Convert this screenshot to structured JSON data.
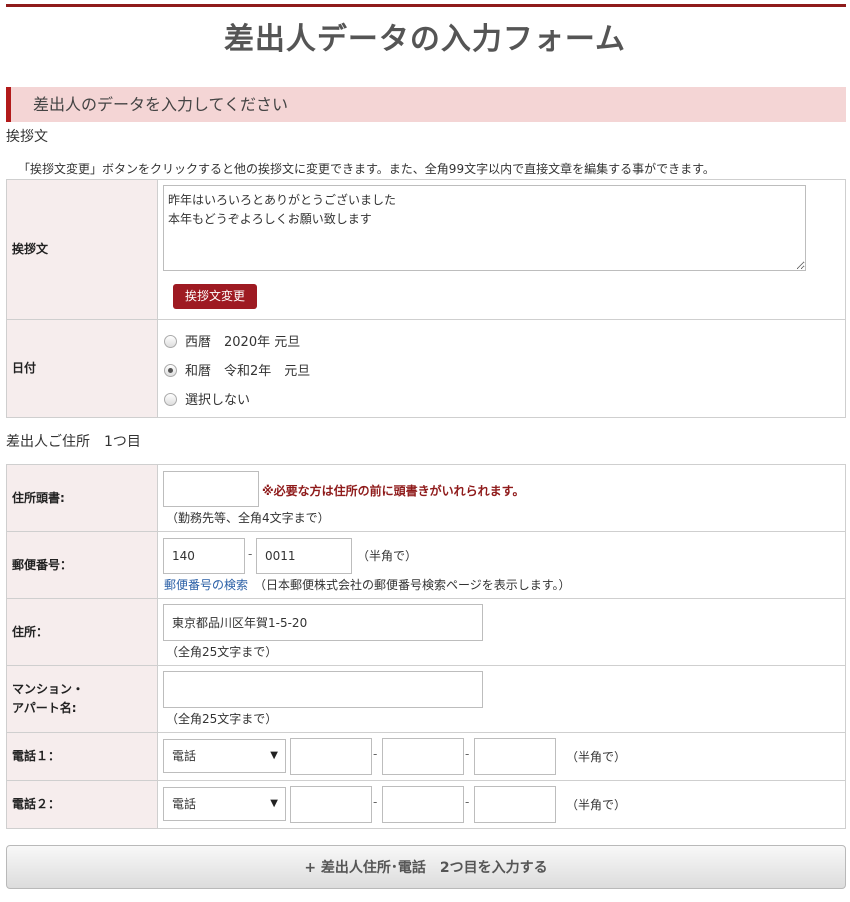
{
  "page": {
    "title": "差出人データの入力フォーム"
  },
  "section": {
    "title": "差出人のデータを入力してください"
  },
  "greeting": {
    "heading": "挨拶文",
    "note": "「挨拶文変更」ボタンをクリックすると他の挨拶文に変更できます。また、全角99文字以内で直接文章を編集する事ができます。",
    "label": "挨拶文",
    "text": "昨年はいろいろとありがとうございました\n本年もどうぞよろしくお願い致します",
    "change_button": "挨拶文変更"
  },
  "date": {
    "label": "日付",
    "options": [
      {
        "label": "西暦　2020年 元旦",
        "checked": false
      },
      {
        "label": "和暦　令和2年　元旦",
        "checked": true
      },
      {
        "label": "選択しない",
        "checked": false
      }
    ]
  },
  "address1": {
    "heading": "差出人ご住所　1つ目",
    "prefix": {
      "label": "住所頭書:",
      "value": "",
      "warning": "※必要な方は住所の前に頭書きがいれられます。",
      "hint": "（勤務先等、全角4文字まで）"
    },
    "postal": {
      "label": "郵便番号：",
      "part1": "140",
      "part2": "0011",
      "separator": "-",
      "hint": "（半角で）",
      "link": "郵便番号の検索",
      "link_note": "（日本郵便株式会社の郵便番号検索ページを表示します。）"
    },
    "address": {
      "label": "住所：",
      "value": "東京都品川区年賀1-5-20",
      "hint": "（全角25文字まで）"
    },
    "building": {
      "label_line1": "マンション・",
      "label_line2": "アパート名:",
      "value": "",
      "hint": "（全角25文字まで）"
    },
    "phone1": {
      "label": "電話１：",
      "type": "電話",
      "separator": "-",
      "hint": "（半角で）"
    },
    "phone2": {
      "label": "電話２：",
      "type": "電話",
      "separator": "-",
      "hint": "（半角で）"
    }
  },
  "add_button": "+ 差出人住所･電話　2つ目を入力する",
  "colors": {
    "accent": "#9e1a22",
    "header_bg": "#f4d5d5",
    "label_bg": "#f6eded",
    "link": "#2a5fa6"
  }
}
